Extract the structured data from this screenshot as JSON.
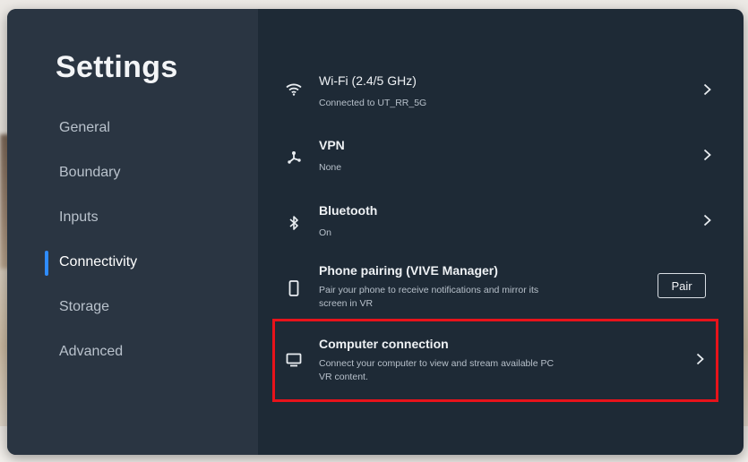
{
  "sidebar": {
    "title": "Settings",
    "items": [
      {
        "label": "General",
        "active": false
      },
      {
        "label": "Boundary",
        "active": false
      },
      {
        "label": "Inputs",
        "active": false
      },
      {
        "label": "Connectivity",
        "active": true
      },
      {
        "label": "Storage",
        "active": false
      },
      {
        "label": "Advanced",
        "active": false
      }
    ]
  },
  "connectivity": {
    "wifi": {
      "title": "Wi-Fi (2.4/5 GHz)",
      "subtitle": "Connected to UT_RR_5G",
      "icon": "wifi-icon"
    },
    "vpn": {
      "title": "VPN",
      "subtitle": "None",
      "icon": "vpn-icon"
    },
    "bluetooth": {
      "title": "Bluetooth",
      "subtitle": "On",
      "icon": "bluetooth-icon"
    },
    "phone_pairing": {
      "title": "Phone pairing (VIVE Manager)",
      "subtitle": "Pair your phone to receive notifications and mirror its screen in VR",
      "button_label": "Pair",
      "icon": "phone-icon"
    },
    "computer_connection": {
      "title": "Computer connection",
      "subtitle": "Connect your computer to view and stream available PC VR content.",
      "icon": "monitor-icon"
    }
  },
  "colors": {
    "panel_bg": "#1e2a36",
    "sidebar_bg": "#2a3542",
    "accent": "#2f8cff",
    "highlight": "#e8131b"
  }
}
